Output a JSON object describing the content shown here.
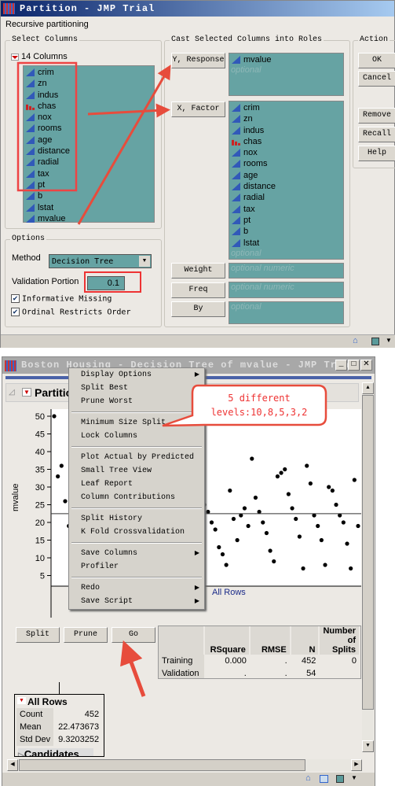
{
  "dialog": {
    "title": "Partition - JMP Trial",
    "subtitle": "Recursive partitioning",
    "select_columns": {
      "label": "Select Columns",
      "count_label": "14 Columns",
      "columns": [
        {
          "name": "crim",
          "type": "continuous"
        },
        {
          "name": "zn",
          "type": "continuous"
        },
        {
          "name": "indus",
          "type": "continuous"
        },
        {
          "name": "chas",
          "type": "nominal"
        },
        {
          "name": "nox",
          "type": "continuous"
        },
        {
          "name": "rooms",
          "type": "continuous"
        },
        {
          "name": "age",
          "type": "continuous"
        },
        {
          "name": "distance",
          "type": "continuous"
        },
        {
          "name": "radial",
          "type": "continuous"
        },
        {
          "name": "tax",
          "type": "continuous"
        },
        {
          "name": "pt",
          "type": "continuous"
        },
        {
          "name": "b",
          "type": "continuous"
        },
        {
          "name": "lstat",
          "type": "continuous"
        },
        {
          "name": "mvalue",
          "type": "continuous"
        }
      ]
    },
    "roles": {
      "label": "Cast Selected Columns into Roles",
      "y_button": "Y, Response",
      "y_values": [
        "mvalue"
      ],
      "y_placeholder": "optional",
      "x_button": "X, Factor",
      "x_values": [
        "crim",
        "zn",
        "indus",
        "chas",
        "nox",
        "rooms",
        "age",
        "distance",
        "radial",
        "tax",
        "pt",
        "b",
        "lstat"
      ],
      "x_placeholder": "optional",
      "weight_button": "Weight",
      "weight_placeholder": "optional numeric",
      "freq_button": "Freq",
      "freq_placeholder": "optional numeric",
      "by_button": "By",
      "by_placeholder": "optional"
    },
    "action": {
      "label": "Action",
      "ok": "OK",
      "cancel": "Cancel",
      "remove": "Remove",
      "recall": "Recall",
      "help": "Help"
    },
    "options": {
      "label": "Options",
      "method_label": "Method",
      "method_value": "Decision Tree",
      "validation_label": "Validation Portion",
      "validation_value": "0.1",
      "informative_missing": "Informative Missing",
      "informative_missing_checked": true,
      "ordinal_restricts": "Ordinal Restricts Order",
      "ordinal_restricts_checked": true
    }
  },
  "report": {
    "title": "Boston Housing - Decision Tree of mvalue - JMP Trial",
    "header": "Partition",
    "menu": [
      {
        "label": "Display Options",
        "sub": true
      },
      {
        "label": "Split Best"
      },
      {
        "label": "Prune Worst"
      },
      {
        "sep": true
      },
      {
        "label": "Minimum Size Split"
      },
      {
        "label": "Lock Columns"
      },
      {
        "sep": true
      },
      {
        "label": "Plot Actual by Predicted"
      },
      {
        "label": "Small Tree View"
      },
      {
        "label": "Leaf Report"
      },
      {
        "label": "Column Contributions"
      },
      {
        "sep": true
      },
      {
        "label": "Split History"
      },
      {
        "label": "K Fold Crossvalidation"
      },
      {
        "sep": true
      },
      {
        "label": "Save Columns",
        "sub": true
      },
      {
        "label": "Profiler"
      },
      {
        "sep": true
      },
      {
        "label": "Redo",
        "sub": true
      },
      {
        "label": "Save Script",
        "sub": true
      }
    ],
    "callout": {
      "line1": "5 different",
      "line2": "levels:10,8,5,3,2"
    },
    "buttons": {
      "split": "Split",
      "prune": "Prune",
      "go": "Go"
    },
    "fit_table": {
      "headers": [
        "",
        "RSquare",
        "RMSE",
        "N",
        "Number of Splits"
      ],
      "rows": [
        [
          "Training",
          "0.000",
          ".",
          "452",
          "0"
        ],
        [
          "Validation",
          ".",
          ".",
          "54",
          ""
        ]
      ]
    },
    "node": {
      "title": "All Rows",
      "rows": [
        [
          "Count",
          "452"
        ],
        [
          "Mean",
          "22.473673"
        ],
        [
          "Std Dev",
          "9.3203252"
        ]
      ],
      "candidates": "Candidates"
    }
  },
  "chart_data": {
    "type": "scatter",
    "ylabel": "mvalue",
    "ylim": [
      2,
      52
    ],
    "yticks": [
      5,
      10,
      15,
      20,
      25,
      30,
      35,
      40,
      45,
      50
    ],
    "xlabel_segment": "All Rows",
    "mean_line": 22.47,
    "points_y": [
      50,
      33,
      36,
      26,
      19,
      18,
      20,
      23,
      22,
      14,
      13,
      10,
      17,
      25,
      37,
      28,
      44,
      45,
      47,
      41,
      43,
      42,
      36,
      32,
      26,
      25,
      23,
      21,
      19,
      14,
      14,
      10,
      31,
      34,
      24,
      22,
      20,
      16,
      9,
      5,
      30,
      25,
      23,
      20,
      18,
      13,
      11,
      8,
      29,
      21,
      15,
      22,
      24,
      19,
      38,
      27,
      23,
      20,
      17,
      12,
      9,
      33,
      34,
      35,
      28,
      24,
      21,
      16,
      7,
      36,
      31,
      22,
      19,
      15,
      8,
      30,
      29,
      25,
      22,
      20,
      14,
      7,
      32,
      19
    ]
  }
}
